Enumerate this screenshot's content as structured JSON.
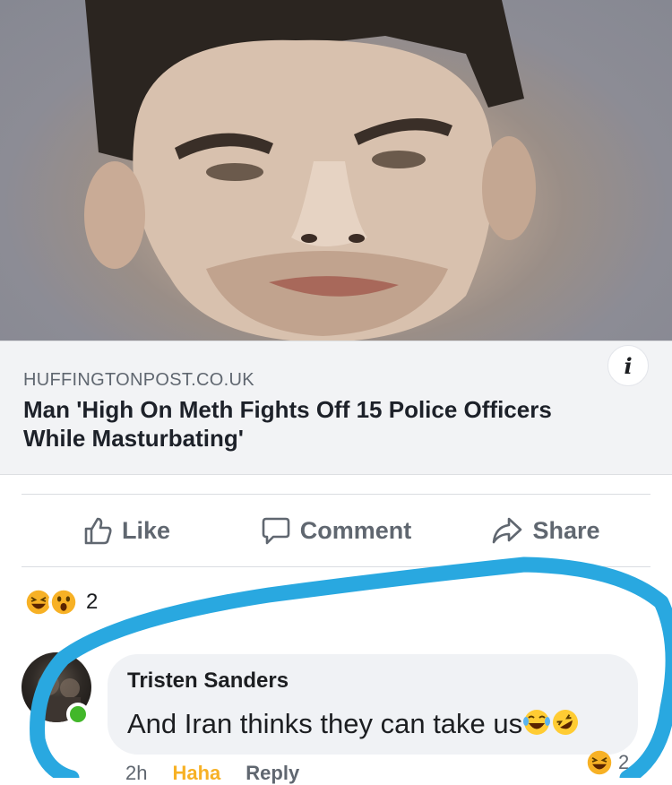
{
  "link": {
    "domain": "HUFFINGTONPOST.CO.UK",
    "headline": "Man 'High On Meth Fights Off 15 Police Officers While Masturbating'",
    "info_label": "i"
  },
  "actions": {
    "like": "Like",
    "comment": "Comment",
    "share": "Share"
  },
  "reactions": {
    "icons": [
      "haha-emoji-icon",
      "wow-emoji-icon"
    ],
    "count": "2"
  },
  "comment": {
    "author": "Tristen Sanders",
    "text": "And Iran thinks they can take us",
    "emojis": [
      "tears-of-joy-emoji-icon",
      "rolling-laughing-emoji-icon"
    ],
    "time": "2h",
    "haha_label": "Haha",
    "reply_label": "Reply",
    "reaction_icon": "haha-emoji-icon",
    "reaction_count": "2"
  },
  "colors": {
    "highlight_stroke": "#29a8e0",
    "facebook_gray": "#606770",
    "haha_yellow": "#f7b125",
    "online_green": "#42b72a"
  }
}
